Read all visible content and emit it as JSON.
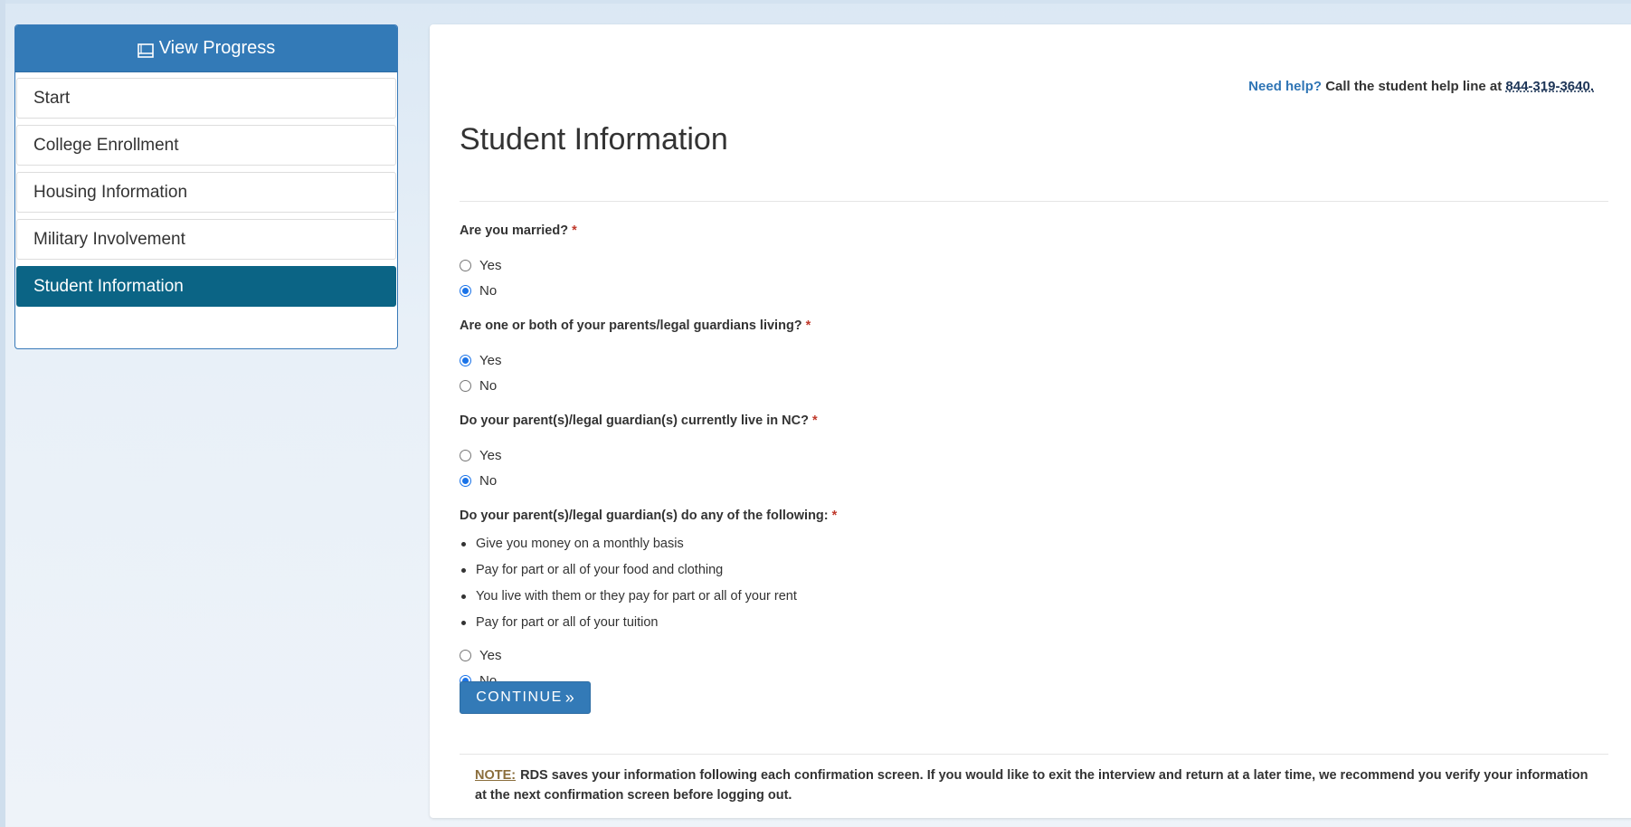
{
  "sidebar": {
    "header": "View Progress",
    "items": [
      {
        "label": "Start",
        "active": false
      },
      {
        "label": "College Enrollment",
        "active": false
      },
      {
        "label": "Housing Information",
        "active": false
      },
      {
        "label": "Military Involvement",
        "active": false
      },
      {
        "label": "Student Information",
        "active": true
      }
    ]
  },
  "help": {
    "need_help": "Need help?",
    "text": "Call the student help line at",
    "phone": "844-319-3640."
  },
  "page_title": "Student Information",
  "questions": [
    {
      "text": "Are you married?",
      "required_mark": "*",
      "options": [
        "Yes",
        "No"
      ],
      "selected": "No"
    },
    {
      "text": "Are one or both of your parents/legal guardians living?",
      "required_mark": "*",
      "options": [
        "Yes",
        "No"
      ],
      "selected": "Yes"
    },
    {
      "text": "Do your parent(s)/legal guardian(s) currently live in NC?",
      "required_mark": "*",
      "options": [
        "Yes",
        "No"
      ],
      "selected": "No"
    },
    {
      "text": "Do your parent(s)/legal guardian(s) do any of the following:",
      "required_mark": "*",
      "options": [
        "Yes",
        "No"
      ],
      "selected": "No",
      "bullets": [
        "Give you money on a monthly basis",
        "Pay for part or all of your food and clothing",
        "You live with them or they pay for part or all of your rent",
        "Pay for part or all of your tuition"
      ]
    }
  ],
  "continue_label": "CONTINUE",
  "continue_icon": "»",
  "note": {
    "label": "NOTE:",
    "text": "RDS saves your information following each confirmation screen. If you would like to exit the interview and return at a later time, we recommend you verify your information at the next confirmation screen before logging out."
  },
  "colors": {
    "primary": "#337ab7",
    "active_item": "#0b6485",
    "required": "#c0392b",
    "note_label": "#8a6d3b"
  }
}
